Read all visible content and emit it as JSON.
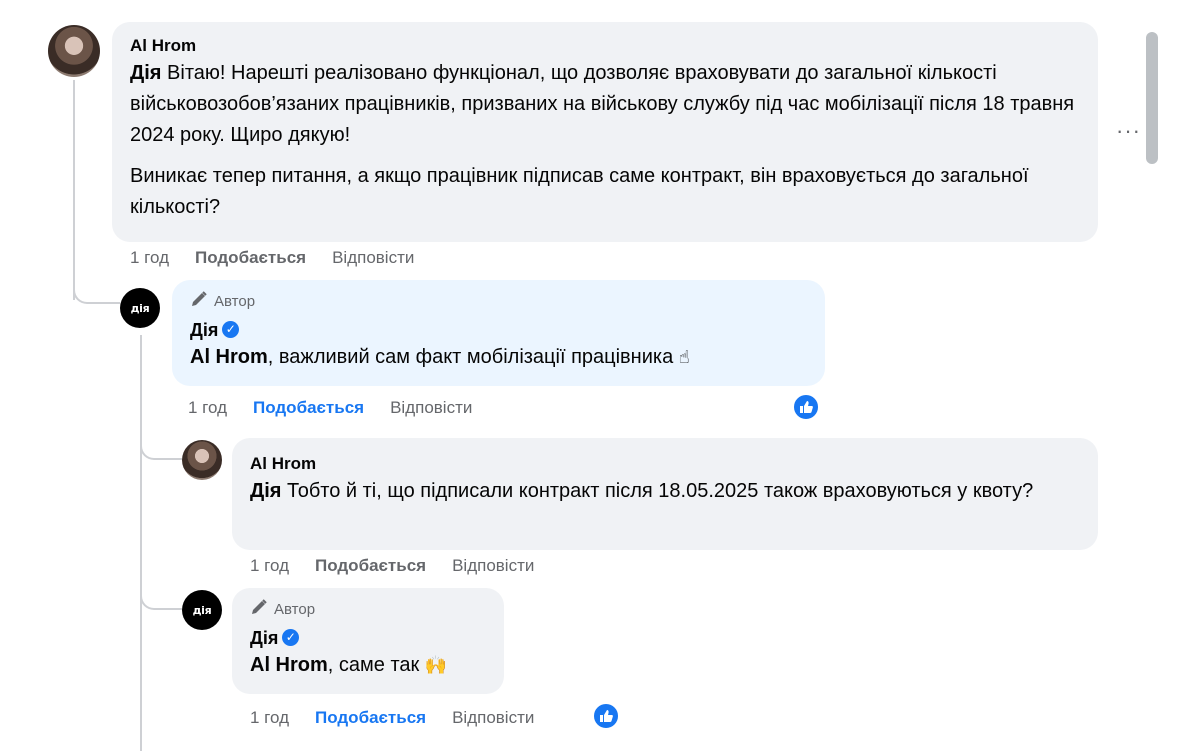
{
  "comments": [
    {
      "author": "Al Hrom",
      "mention": "Дія",
      "paragraphs": [
        "Вітаю! Нарешті реалізовано функціонал, що дозволяє враховувати до загальної кількості військовозобов’язаних працівників, призваних на військову службу під час мобілізації після 18 травня 2024 року. Щиро дякую!",
        "Виникає тепер питання, а якщо працівник підписав саме контракт, він враховується до загальної кількості?"
      ],
      "time": "1 год",
      "like_label": "Подобається",
      "reply_label": "Відповісти"
    },
    {
      "author_badge": "Автор",
      "author": "Дія",
      "avatar_text": "дія",
      "mention": "Al Hrom",
      "text": ", важливий сам факт мобілізації працівника",
      "emoji": "☝",
      "time": "1 год",
      "like_label": "Подобається",
      "reply_label": "Відповісти"
    },
    {
      "author": "Al Hrom",
      "mention": "Дія",
      "text": "Тобто й ті, що підписали контракт після 18.05.2025 також враховуються у квоту?",
      "time": "1 год",
      "like_label": "Подобається",
      "reply_label": "Відповісти"
    },
    {
      "author_badge": "Автор",
      "author": "Дія",
      "avatar_text": "дія",
      "mention": "Al Hrom",
      "text": ", саме так",
      "emoji": "🙌",
      "time": "1 год",
      "like_label": "Подобається",
      "reply_label": "Відповісти"
    }
  ],
  "more_label": "···",
  "colors": {
    "bubble": "#f0f2f5",
    "author_bubble": "#ebf5ff",
    "accent": "#1877f2",
    "muted": "#65676b"
  }
}
